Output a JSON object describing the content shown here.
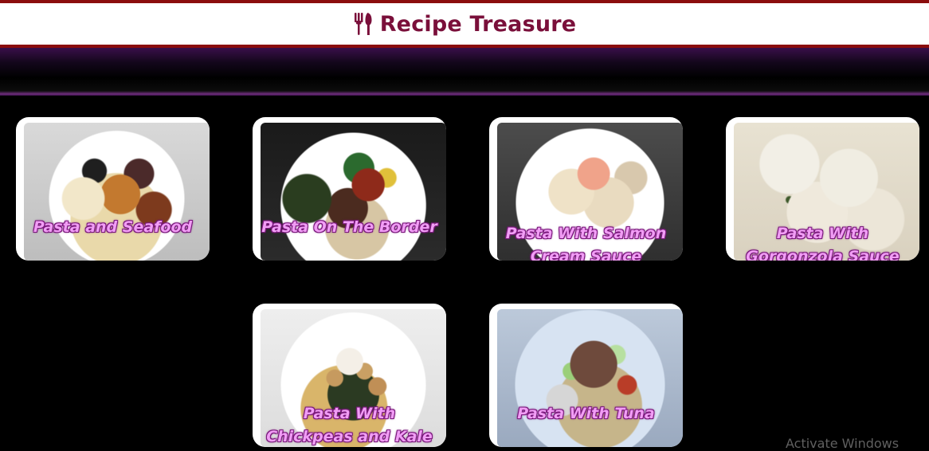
{
  "app": {
    "title": "Recipe Treasure",
    "brand_icon": "utensils-icon"
  },
  "recipes": [
    {
      "title": "Pasta and Seafood"
    },
    {
      "title": "Pasta On The Border"
    },
    {
      "title": "Pasta With Salmon Cream Sauce"
    },
    {
      "title": "Pasta With Gorgonzola Sauce"
    },
    {
      "title": "Pasta With Chickpeas and Kale"
    },
    {
      "title": "Pasta With Tuna"
    }
  ],
  "watermark": {
    "text": "Activate Windows"
  },
  "colors": {
    "header_border": "#8b0d0d",
    "brand_text": "#7a0f3a",
    "card_title": "#f19df5",
    "background": "#000000"
  }
}
